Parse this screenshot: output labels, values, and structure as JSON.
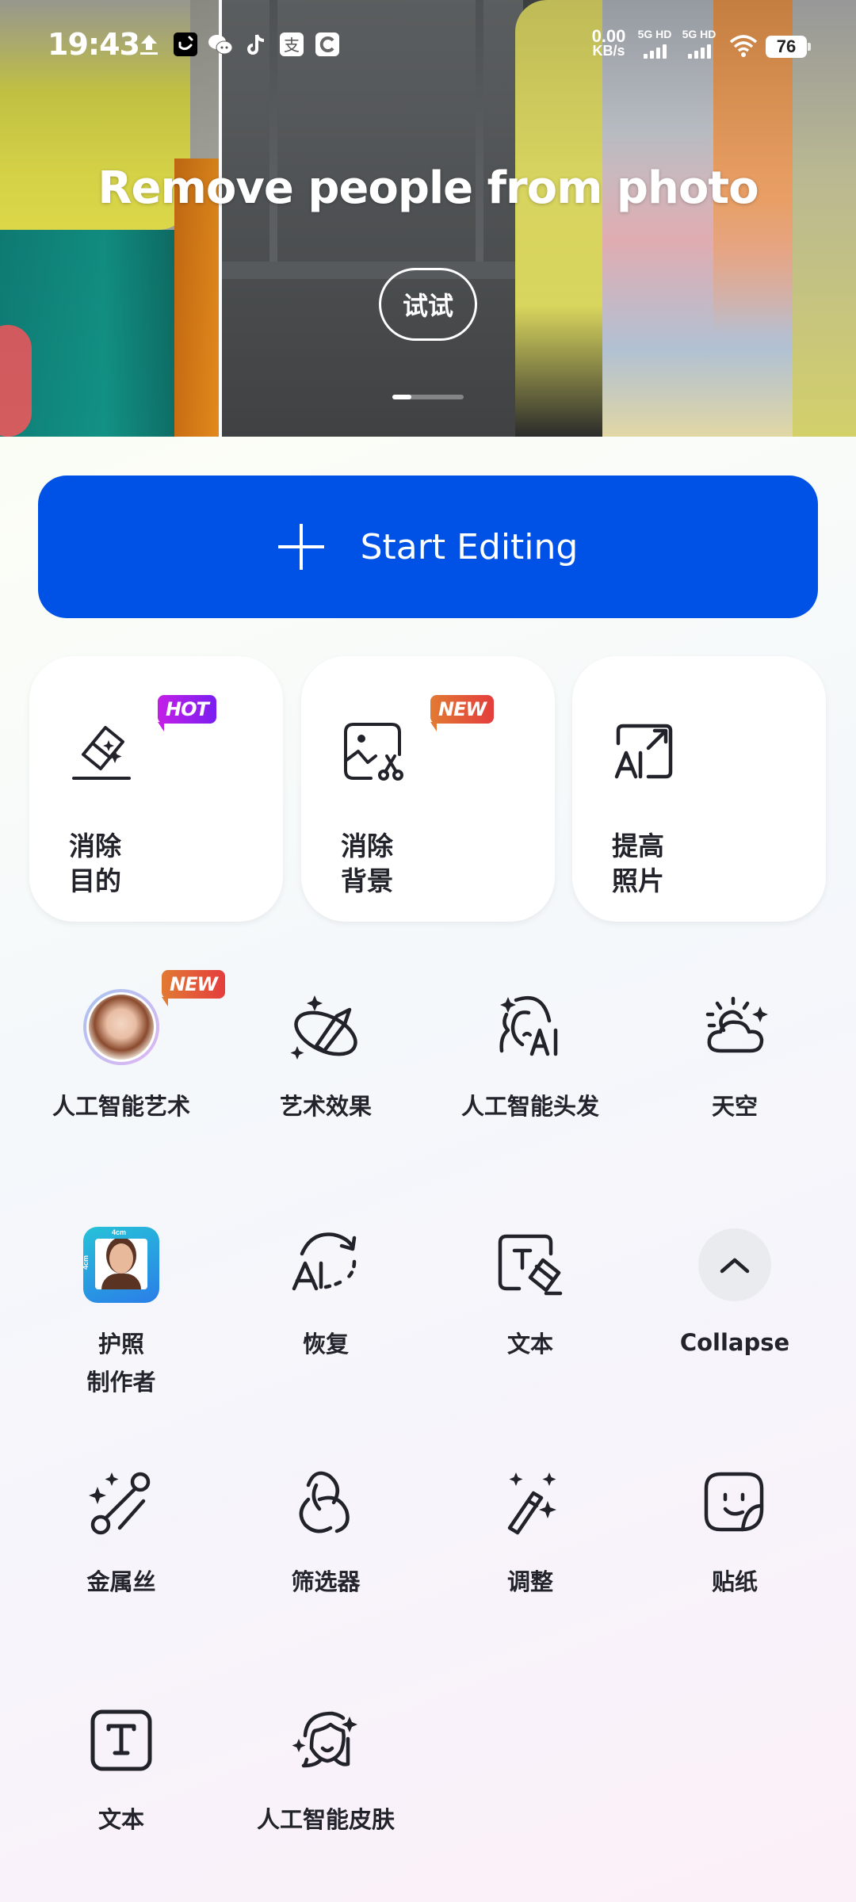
{
  "status_bar": {
    "time": "19:43",
    "notification_icons": [
      "upload-icon",
      "smile-app-icon",
      "wechat-icon",
      "tiktok-icon",
      "alipay-icon",
      "bank-app-icon"
    ],
    "net_speed_value": "0.00",
    "net_speed_unit": "KB/s",
    "sim1_label": "5G HD",
    "sim2_label": "5G HD",
    "battery": "76"
  },
  "hero": {
    "title": "Remove people from photo",
    "try_button": "试试",
    "pager": {
      "current": 1,
      "total": 4
    }
  },
  "start_button": {
    "icon": "plus-icon",
    "label": "Start Editing",
    "color": "#0052e6"
  },
  "feature_cards": [
    {
      "label_line1": "消除",
      "label_line2": "目的",
      "icon": "eraser-sparkle-icon",
      "badge": "HOT"
    },
    {
      "label_line1": "消除",
      "label_line2": "背景",
      "icon": "image-scissors-icon",
      "badge": "NEW"
    },
    {
      "label_line1": "提高",
      "label_line2": "照片",
      "icon": "ai-upscale-icon",
      "badge": null
    }
  ],
  "tools": [
    {
      "label": "人工智能艺术",
      "icon": "ai-art-avatar",
      "badge": "NEW"
    },
    {
      "label": "艺术效果",
      "icon": "brush-orbit-icon"
    },
    {
      "label": "人工智能头发",
      "icon": "ai-hair-icon"
    },
    {
      "label": "天空",
      "icon": "sun-cloud-icon"
    },
    {
      "label": "护照制作者",
      "label_line1": "护照",
      "label_line2": "制作者",
      "icon": "passport-photo-icon",
      "passport_size": "4cm"
    },
    {
      "label": "恢复",
      "icon": "ai-restore-icon"
    },
    {
      "label": "文本",
      "icon": "text-eraser-icon"
    },
    {
      "label": "Collapse",
      "icon": "chevron-up-icon"
    },
    {
      "label": "金属丝",
      "icon": "wire-sparkle-icon"
    },
    {
      "label": "筛选器",
      "icon": "filter-rings-icon"
    },
    {
      "label": "调整",
      "icon": "magic-wand-icon"
    },
    {
      "label": "贴纸",
      "icon": "sticker-icon"
    },
    {
      "label": "文本",
      "icon": "text-box-icon"
    },
    {
      "label": "人工智能皮肤",
      "icon": "ai-skin-icon"
    }
  ],
  "badges": {
    "hot": "HOT",
    "new": "NEW"
  }
}
